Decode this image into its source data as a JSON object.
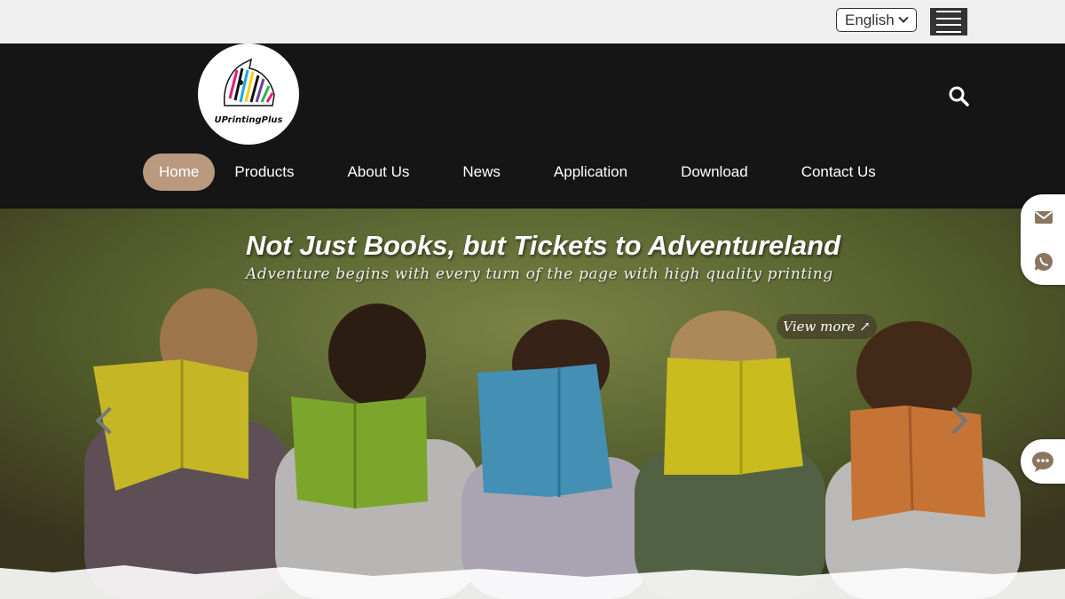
{
  "topbar": {
    "language": "English",
    "menu_icon": "hamburger-icon"
  },
  "header": {
    "logo_text": "UPrintingPlus",
    "search_icon": "search-icon"
  },
  "nav": {
    "items": [
      {
        "label": "Home",
        "active": true
      },
      {
        "label": "Products",
        "active": false
      },
      {
        "label": "About Us",
        "active": false
      },
      {
        "label": "News",
        "active": false
      },
      {
        "label": "Application",
        "active": false
      },
      {
        "label": "Download",
        "active": false
      },
      {
        "label": "Contact Us",
        "active": false
      }
    ]
  },
  "hero": {
    "title": "Not Just Books, but Tickets to Adventureland",
    "subtitle": "Adventure begins with every turn of the page with high quality printing",
    "cta": "View more ↗",
    "prev_icon": "chevron-left-icon",
    "next_icon": "chevron-right-icon"
  },
  "side": {
    "email_icon": "email-icon",
    "whatsapp_icon": "whatsapp-icon",
    "chat_icon": "chat-icon"
  },
  "colors": {
    "header_bg": "#151515",
    "topbar_bg": "#efefef",
    "nav_active": "#b99a7e",
    "side_icon": "#8a7560"
  }
}
